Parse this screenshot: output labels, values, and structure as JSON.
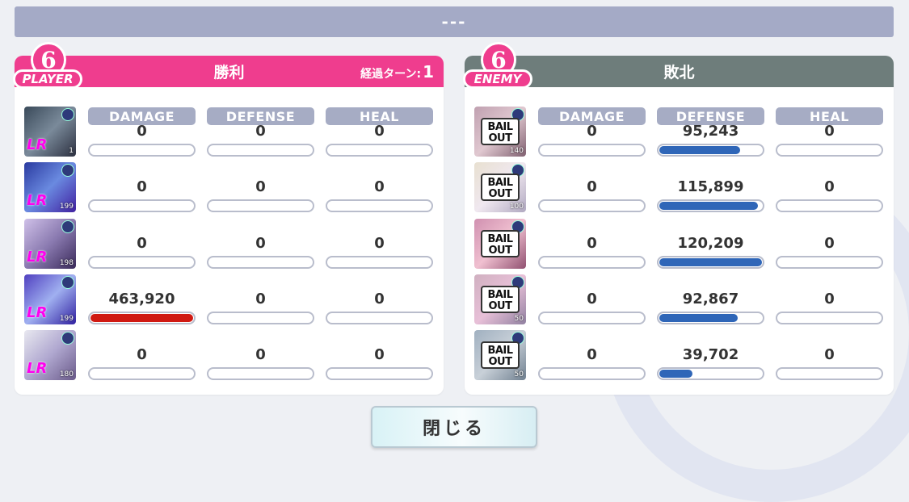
{
  "title": "---",
  "player": {
    "badge_label": "PLAYER",
    "result": "勝利",
    "turn_label": "経過ターン:",
    "turn_value": "1",
    "column_headers": [
      "DAMAGE",
      "DEFENSE",
      "HEAL"
    ],
    "rows": [
      {
        "level": "1",
        "rarity": "LR",
        "damage": "0",
        "defense": "0",
        "heal": "0",
        "damage_fill": 0,
        "defense_fill": 0
      },
      {
        "level": "199",
        "rarity": "LR",
        "damage": "0",
        "defense": "0",
        "heal": "0",
        "damage_fill": 0,
        "defense_fill": 0
      },
      {
        "level": "198",
        "rarity": "LR",
        "damage": "0",
        "defense": "0",
        "heal": "0",
        "damage_fill": 0,
        "defense_fill": 0
      },
      {
        "level": "199",
        "rarity": "LR",
        "damage": "463,920",
        "defense": "0",
        "heal": "0",
        "damage_fill": 1.0,
        "defense_fill": 0
      },
      {
        "level": "180",
        "rarity": "LR",
        "damage": "0",
        "defense": "0",
        "heal": "0",
        "damage_fill": 0,
        "defense_fill": 0
      }
    ]
  },
  "enemy": {
    "badge_label": "ENEMY",
    "result": "敗北",
    "column_headers": [
      "DAMAGE",
      "DEFENSE",
      "HEAL"
    ],
    "rows": [
      {
        "bail": "BAIL OUT",
        "level": "140",
        "damage": "0",
        "defense": "95,243",
        "heal": "0",
        "defense_fill": 0.79
      },
      {
        "bail": "BAIL OUT",
        "level": "100",
        "damage": "0",
        "defense": "115,899",
        "heal": "0",
        "defense_fill": 0.96
      },
      {
        "bail": "BAIL OUT",
        "level": "",
        "damage": "0",
        "defense": "120,209",
        "heal": "0",
        "defense_fill": 1.0
      },
      {
        "bail": "BAIL OUT",
        "level": "50",
        "damage": "0",
        "defense": "92,867",
        "heal": "0",
        "defense_fill": 0.77
      },
      {
        "bail": "BAIL OUT",
        "level": "50",
        "damage": "0",
        "defense": "39,702",
        "heal": "0",
        "defense_fill": 0.33
      }
    ]
  },
  "close_button": "閉じる",
  "colors": {
    "player": "#ef3d8e",
    "enemy": "#6e7d7b",
    "damage": "#d01a12",
    "defense": "#2f66b8"
  }
}
